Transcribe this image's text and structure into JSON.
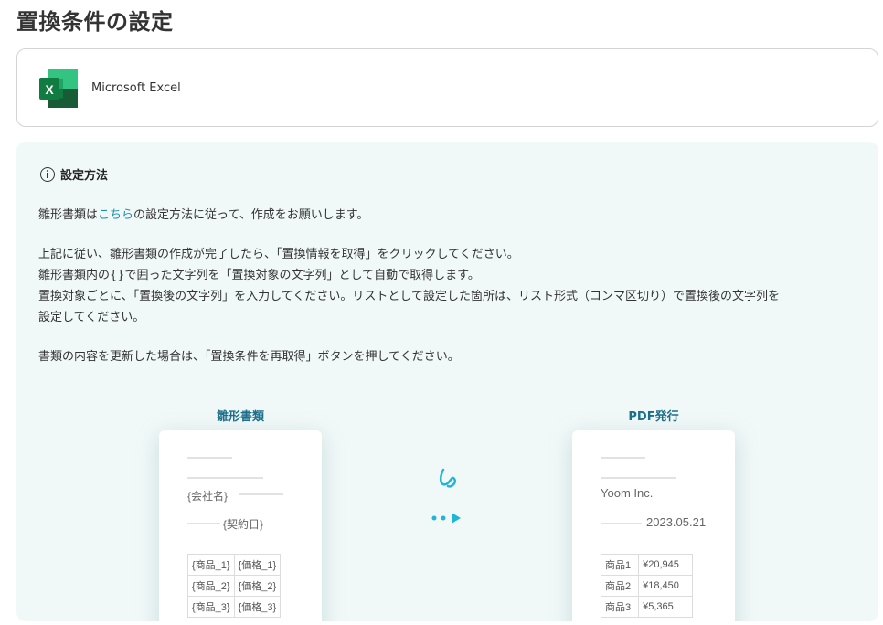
{
  "page": {
    "title": "置換条件の設定"
  },
  "app": {
    "name": "Microsoft Excel",
    "icon": "excel-icon",
    "icon_letter": "X",
    "accent": "#1d6f42"
  },
  "info": {
    "icon": "info-icon",
    "title": "設定方法",
    "line1_pre": "雛形書類は",
    "line1_link": "こちら",
    "line1_post": "の設定方法に従って、作成をお願いします。",
    "line2": "上記に従い、雛形書類の作成が完了したら、「置換情報を取得」をクリックしてください。",
    "line3": "雛形書類内の{}で囲った文字列を「置換対象の文字列」として自動で取得します。",
    "line4": "置換対象ごとに、「置換後の文字列」を入力してください。リストとして設定した箇所は、リスト形式（コンマ区切り）で置換後の文字列を",
    "line5": "設定してください。",
    "line6": "書類の内容を更新した場合は、「置換条件を再取得」ボタンを押してください。",
    "link_color": "#1a8fb0"
  },
  "illustration": {
    "template": {
      "label": "雛形書類",
      "company": "{会社名}",
      "date": "{契約日}",
      "rows": [
        [
          "{商品_1}",
          "{価格_1}"
        ],
        [
          "{商品_2}",
          "{価格_2}"
        ],
        [
          "{商品_3}",
          "{価格_3}"
        ]
      ]
    },
    "output": {
      "label": "PDF発行",
      "company": "Yoom Inc.",
      "date": "2023.05.21",
      "rows": [
        [
          "商品1",
          "¥20,945"
        ],
        [
          "商品2",
          "¥18,450"
        ],
        [
          "商品3",
          "¥5,365"
        ]
      ]
    },
    "arrow_color": "#1fb5d4"
  }
}
